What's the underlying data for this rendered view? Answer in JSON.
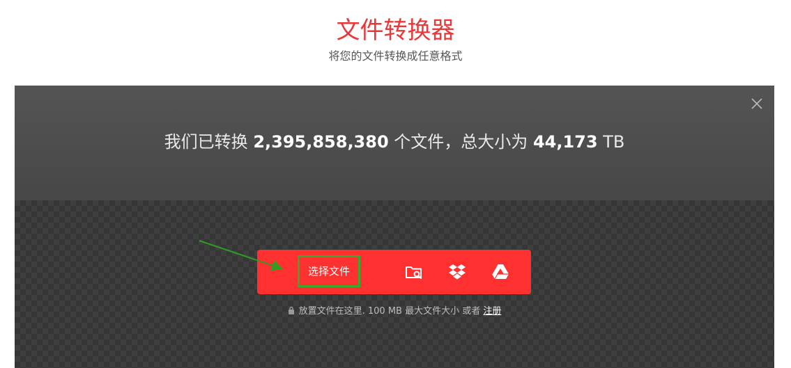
{
  "header": {
    "title": "文件转换器",
    "subtitle": "将您的文件转换成任意格式"
  },
  "stats": {
    "prefix": "我们已转换",
    "file_count": "2,395,858,380",
    "middle": "个文件，总大小为",
    "total_size": "44,173",
    "unit": "TB"
  },
  "uploader": {
    "choose_label": "选择文件",
    "icons": [
      "folder-search-icon",
      "dropbox-icon",
      "google-drive-icon"
    ],
    "hint_text": "放置文件在这里. 100 MB 最大文件大小 或者",
    "register_link": "注册"
  },
  "colors": {
    "title": "#e8383a",
    "toolbar": "#ff3030",
    "highlight_border": "#3ba72b",
    "stats_bg": "#4d4d4d"
  }
}
